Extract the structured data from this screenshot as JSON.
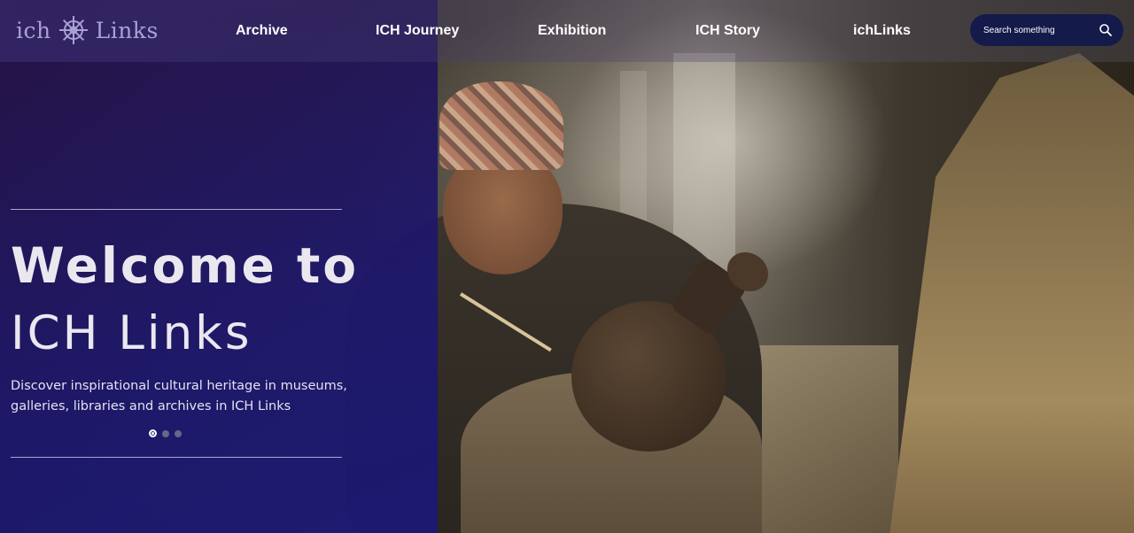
{
  "header": {
    "logo_left": "ich",
    "logo_right": "Links",
    "logo_icon": "ship-wheel-icon",
    "nav": [
      {
        "label": "Archive"
      },
      {
        "label": "ICH Journey"
      },
      {
        "label": "Exhibition"
      },
      {
        "label": "ICH Story"
      },
      {
        "label": "ichLinks"
      }
    ],
    "search": {
      "placeholder": "Search something",
      "icon": "search-icon"
    }
  },
  "hero": {
    "welcome": "Welcome to",
    "title": "ICH Links",
    "description": "Discover inspirational cultural heritage in museums, galleries, libraries and archives in ICH Links",
    "slides": {
      "count": 3,
      "active": 1
    }
  },
  "colors": {
    "panel": "#1c166e",
    "search_bg": "#141a4a",
    "logo": "#a9a1d4"
  }
}
